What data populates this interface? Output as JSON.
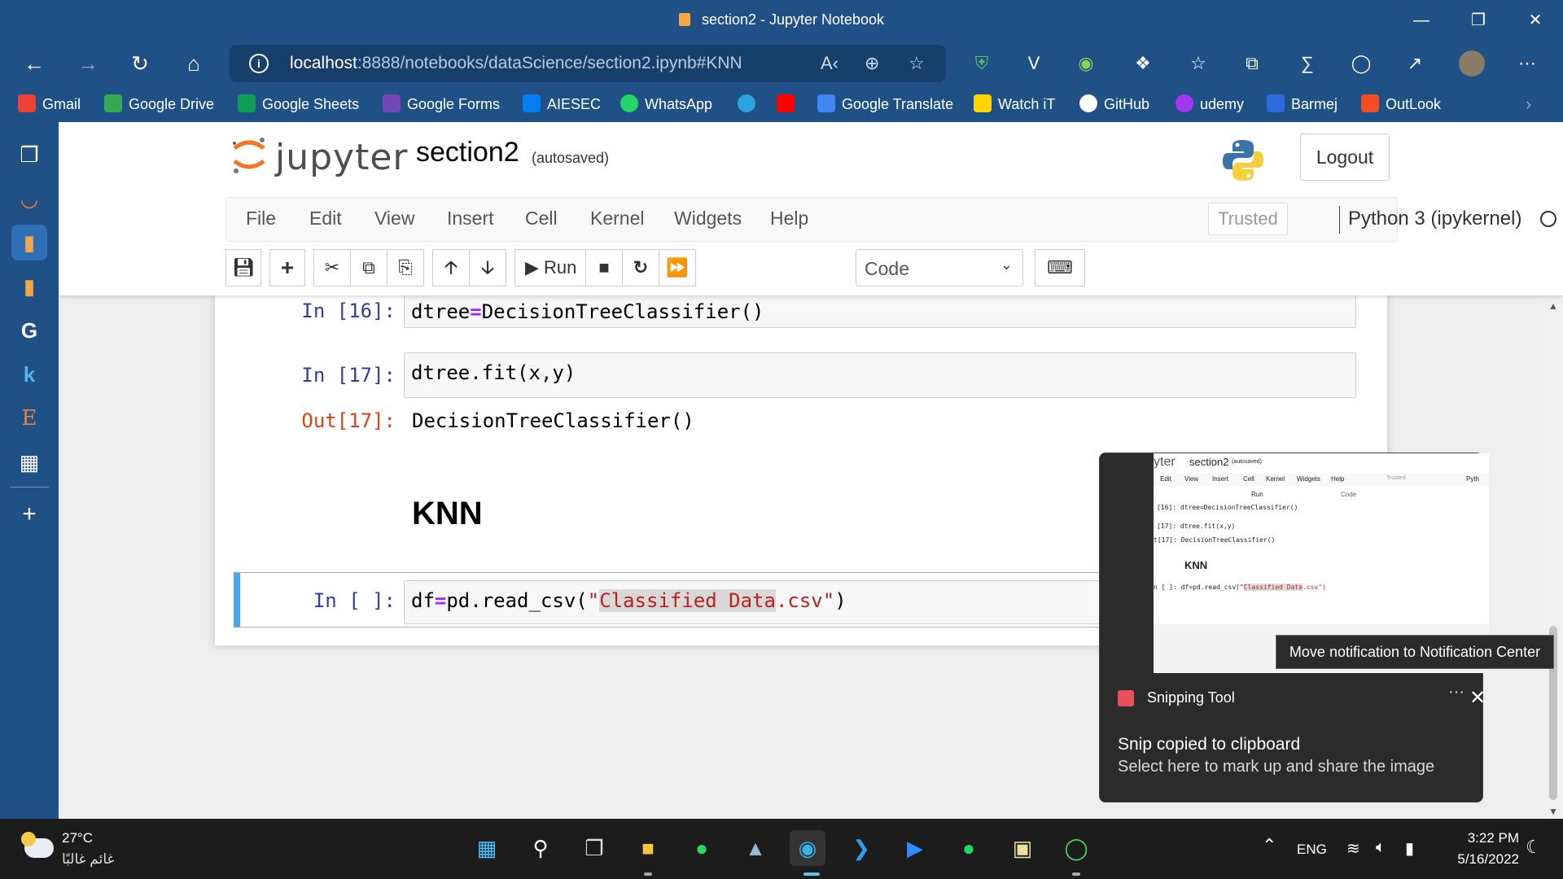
{
  "window": {
    "title": "section2 - Jupyter Notebook"
  },
  "browser": {
    "url_host": "localhost",
    "url_rest": ":8888/notebooks/dataScience/section2.ipynb#KNN"
  },
  "bookmarks": [
    {
      "label": "Gmail",
      "color": "#ea4335"
    },
    {
      "label": "Google Drive",
      "color": "#34a853"
    },
    {
      "label": "Google Sheets",
      "color": "#0f9d58"
    },
    {
      "label": "Google Forms",
      "color": "#7248b9"
    },
    {
      "label": "AIESEC",
      "color": "#037ef3"
    },
    {
      "label": "WhatsApp",
      "color": "#25d366"
    },
    {
      "label": "Google Translate",
      "color": "#4285f4"
    },
    {
      "label": "Watch iT",
      "color": "#ffd400"
    },
    {
      "label": "GitHub",
      "color": "#ffffff"
    },
    {
      "label": "udemy",
      "color": "#a435f0"
    },
    {
      "label": "Barmej",
      "color": "#2d6cdf"
    },
    {
      "label": "OutLook",
      "color": "#f25022"
    }
  ],
  "jupyter": {
    "logo_text": "jupyter",
    "notebook_name": "section2",
    "autosave_status": "(autosaved)",
    "logout_label": "Logout",
    "menus": [
      "File",
      "Edit",
      "View",
      "Insert",
      "Cell",
      "Kernel",
      "Widgets",
      "Help"
    ],
    "trusted_label": "Trusted",
    "kernel_name": "Python 3 (ipykernel)",
    "run_label": "Run",
    "cell_type": "Code"
  },
  "cells": {
    "c16": {
      "prompt": "In [16]:",
      "code_a": "dtree",
      "code_op": "=",
      "code_b": "DecisionTreeClassifier()"
    },
    "c17": {
      "prompt": "In [17]:",
      "code": "dtree.fit(x,y)",
      "out_prompt": "Out[17]:",
      "output": "DecisionTreeClassifier()"
    },
    "heading": "KNN",
    "c18": {
      "prompt": "In [ ]:",
      "code_a": "df",
      "code_op": "=",
      "code_b": "pd.read_csv(",
      "str_q1": "\"",
      "str_hl": "Classified Data",
      "str_rest": ".csv\"",
      "code_end": ")"
    }
  },
  "notification": {
    "app_name": "Snipping Tool",
    "headline": "Snip copied to clipboard",
    "body": "Select here to mark up and share the image",
    "tooltip": "Move notification to Notification Center",
    "more_label": "···"
  },
  "preview": {
    "brand": "yter",
    "name": "section2",
    "saved": "(autosaved)",
    "menus": [
      "Edit",
      "View",
      "Insert",
      "Cell",
      "Kernel",
      "Widgets",
      "Help"
    ],
    "trusted": "Trusted",
    "kernel": "Pyth",
    "run": "Run",
    "code": "Code",
    "line1": "[16]:  dtree=DecisionTreeClassifier()",
    "line2": "[17]:  dtree.fit(x,y)",
    "line3": "t[17]:  DecisionTreeClassifier()",
    "heading": "KNN",
    "line4a": "n [ ]:  df=pd.read_csv(\"",
    "line4hl": "Classified Data",
    "line4b": ".csv\")"
  },
  "taskbar": {
    "temperature": "27°C",
    "condition": "غائم غالبًا",
    "language": "ENG",
    "time": "3:22 PM",
    "date": "5/16/2022"
  },
  "colors": {
    "chrome": "#1f5086",
    "accent_cell": "#42a5f5",
    "prompt_in": "#303f9f",
    "prompt_out": "#d84315"
  }
}
